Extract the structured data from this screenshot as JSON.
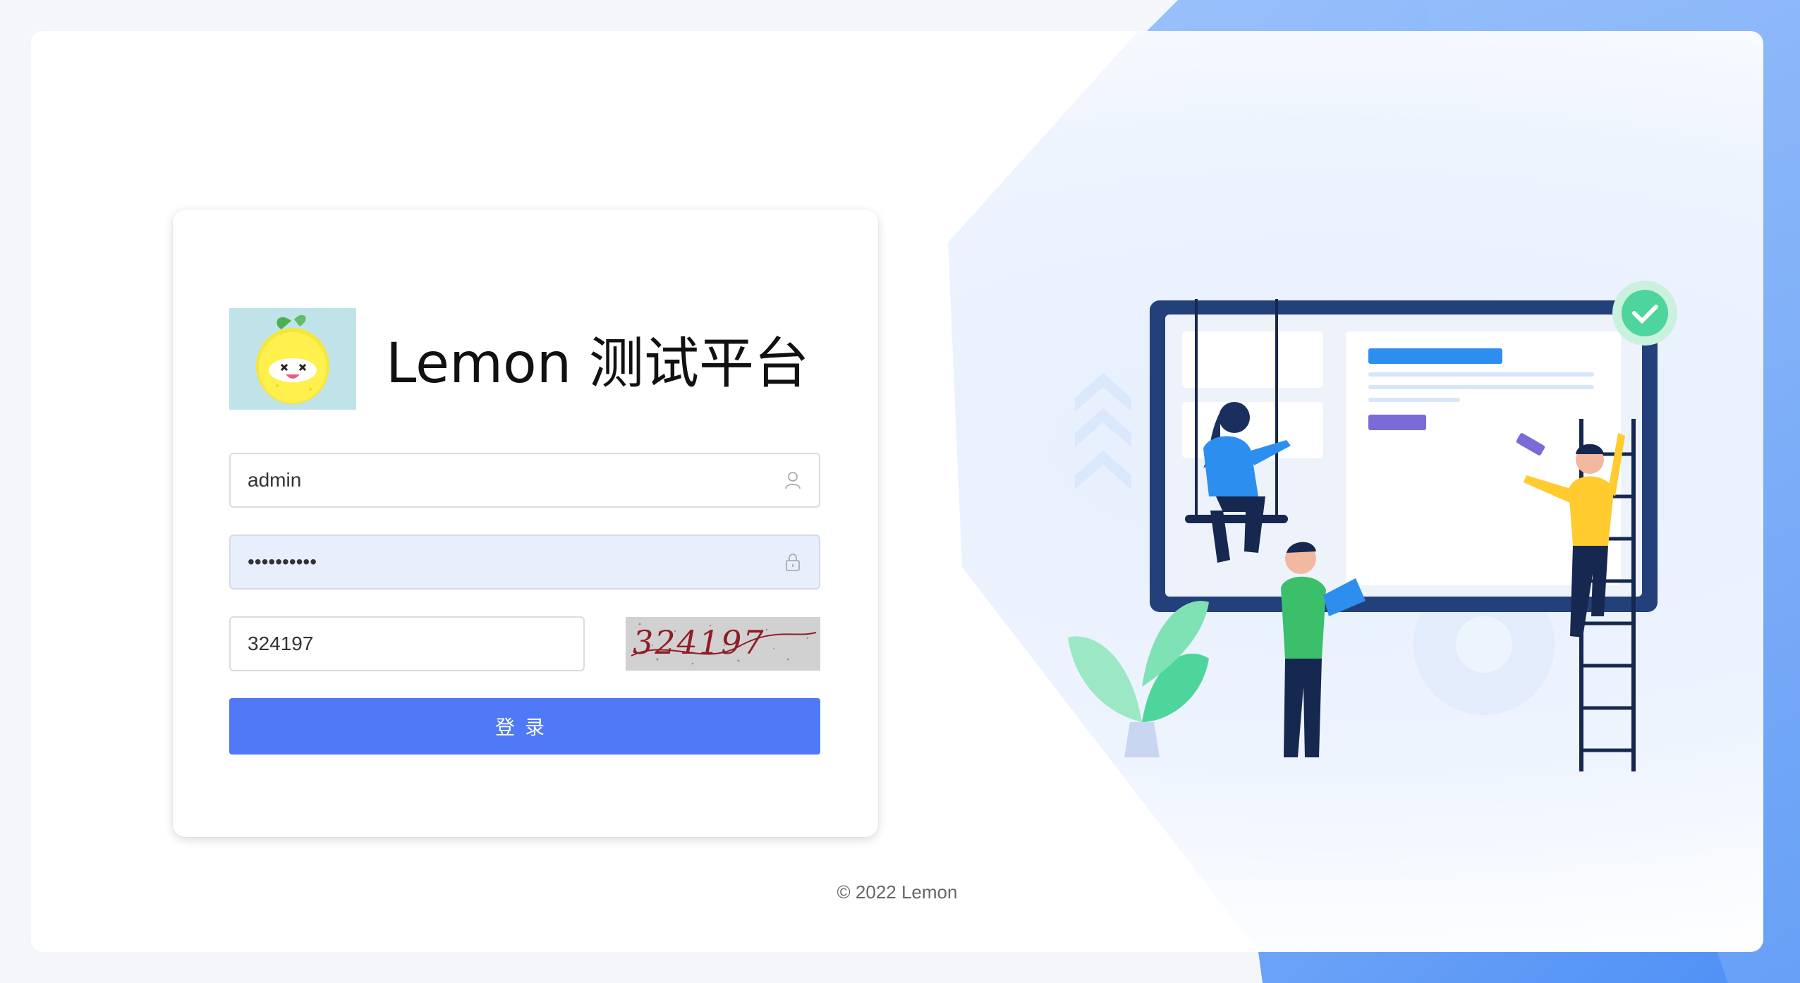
{
  "brand": {
    "title": "Lemon 测试平台",
    "logo": "lemon-mascot-logo"
  },
  "form": {
    "username": {
      "value": "admin",
      "icon": "user-icon"
    },
    "password": {
      "value": "••••••••••",
      "icon": "lock-icon"
    },
    "captcha": {
      "value": "324197",
      "image_text": "324197"
    },
    "submit_label": "登录"
  },
  "footer": {
    "copyright": "© 2022 Lemon"
  },
  "colors": {
    "primary": "#4f79f6",
    "accent_green": "#4ed59b",
    "accent_yellow": "#ffcb2f"
  }
}
